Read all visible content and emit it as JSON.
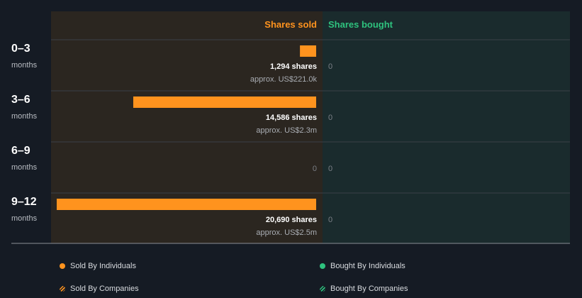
{
  "chart_data": {
    "type": "bar",
    "orientation": "horizontal-diverging",
    "columns": {
      "sold": "Shares sold",
      "bought": "Shares bought"
    },
    "rows": [
      {
        "title": "0–3",
        "subtitle": "months",
        "sold": 1294,
        "sold_label": "1,294 shares",
        "sold_approx": "approx. US$221.0k",
        "bought": 0,
        "bought_label": "0"
      },
      {
        "title": "3–6",
        "subtitle": "months",
        "sold": 14586,
        "sold_label": "14,586 shares",
        "sold_approx": "approx. US$2.3m",
        "bought": 0,
        "bought_label": "0"
      },
      {
        "title": "6–9",
        "subtitle": "months",
        "sold": 0,
        "sold_label": "0",
        "sold_approx": "",
        "bought": 0,
        "bought_label": "0"
      },
      {
        "title": "9–12",
        "subtitle": "months",
        "sold": 20690,
        "sold_label": "20,690 shares",
        "sold_approx": "approx. US$2.5m",
        "bought": 0,
        "bought_label": "0"
      }
    ],
    "xlim": [
      0,
      20690
    ],
    "legend": [
      {
        "label": "Sold By Individuals",
        "style": "solid",
        "color": "#ff931e"
      },
      {
        "label": "Bought By Individuals",
        "style": "solid",
        "color": "#2ec27e"
      },
      {
        "label": "Sold By Companies",
        "style": "hatched",
        "color": "#ff931e"
      },
      {
        "label": "Bought By Companies",
        "style": "hatched",
        "color": "#2ec27e"
      }
    ]
  },
  "colors": {
    "background": "#151b24",
    "sold_panel": "#2b2620",
    "bought_panel": "#1a2b2d",
    "sold_accent": "#ff931e",
    "bought_accent": "#2ec27e",
    "divider": "#3b4047"
  }
}
